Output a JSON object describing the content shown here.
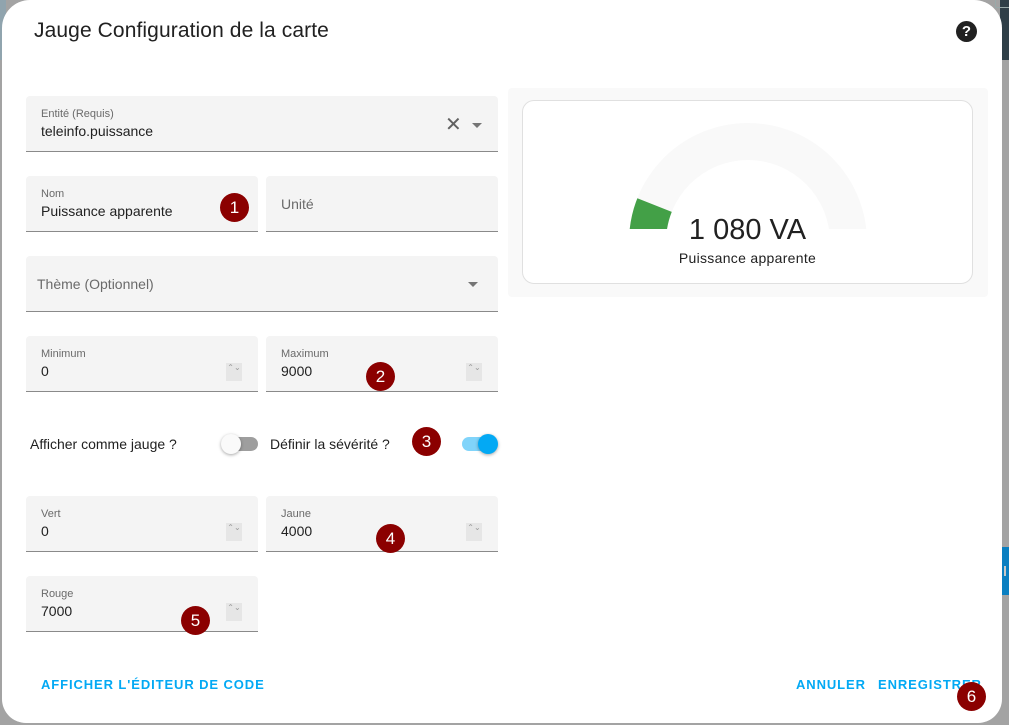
{
  "dialog": {
    "title": "Jauge Configuration de la carte",
    "help_icon": "help-circle-icon",
    "help_glyph": "?"
  },
  "form": {
    "entity": {
      "label": "Entité (Requis)",
      "value": "teleinfo.puissance",
      "clear_glyph": "✕"
    },
    "name": {
      "label": "Nom",
      "value": "Puissance apparente"
    },
    "unit": {
      "placeholder": "Unité"
    },
    "theme": {
      "placeholder": "Thème (Optionnel)"
    },
    "minimum": {
      "label": "Minimum",
      "value": "0"
    },
    "maximum": {
      "label": "Maximum",
      "value": "9000"
    },
    "show_as_gauge": {
      "label": "Afficher comme jauge ?",
      "checked": false
    },
    "define_severity": {
      "label": "Définir la sévérité ?",
      "checked": true
    },
    "green": {
      "label": "Vert",
      "value": "0"
    },
    "yellow": {
      "label": "Jaune",
      "value": "4000"
    },
    "red": {
      "label": "Rouge",
      "value": "7000"
    },
    "spinner_glyph": "⌃⌄"
  },
  "preview": {
    "value_text": "1 080 VA",
    "name": "Puissance apparente",
    "value": 1080,
    "min": 0,
    "max": 9000,
    "fill_color": "#43a047",
    "track_color": "#f9f9f9"
  },
  "annotations": [
    "1",
    "2",
    "3",
    "4",
    "5",
    "6"
  ],
  "footer": {
    "code_editor_label": "AFFICHER L'ÉDITEUR DE CODE",
    "cancel_label": "ANNULER",
    "save_label": "ENREGISTRER"
  },
  "colors": {
    "accent": "#03a9f4",
    "badge": "#8b0000"
  }
}
